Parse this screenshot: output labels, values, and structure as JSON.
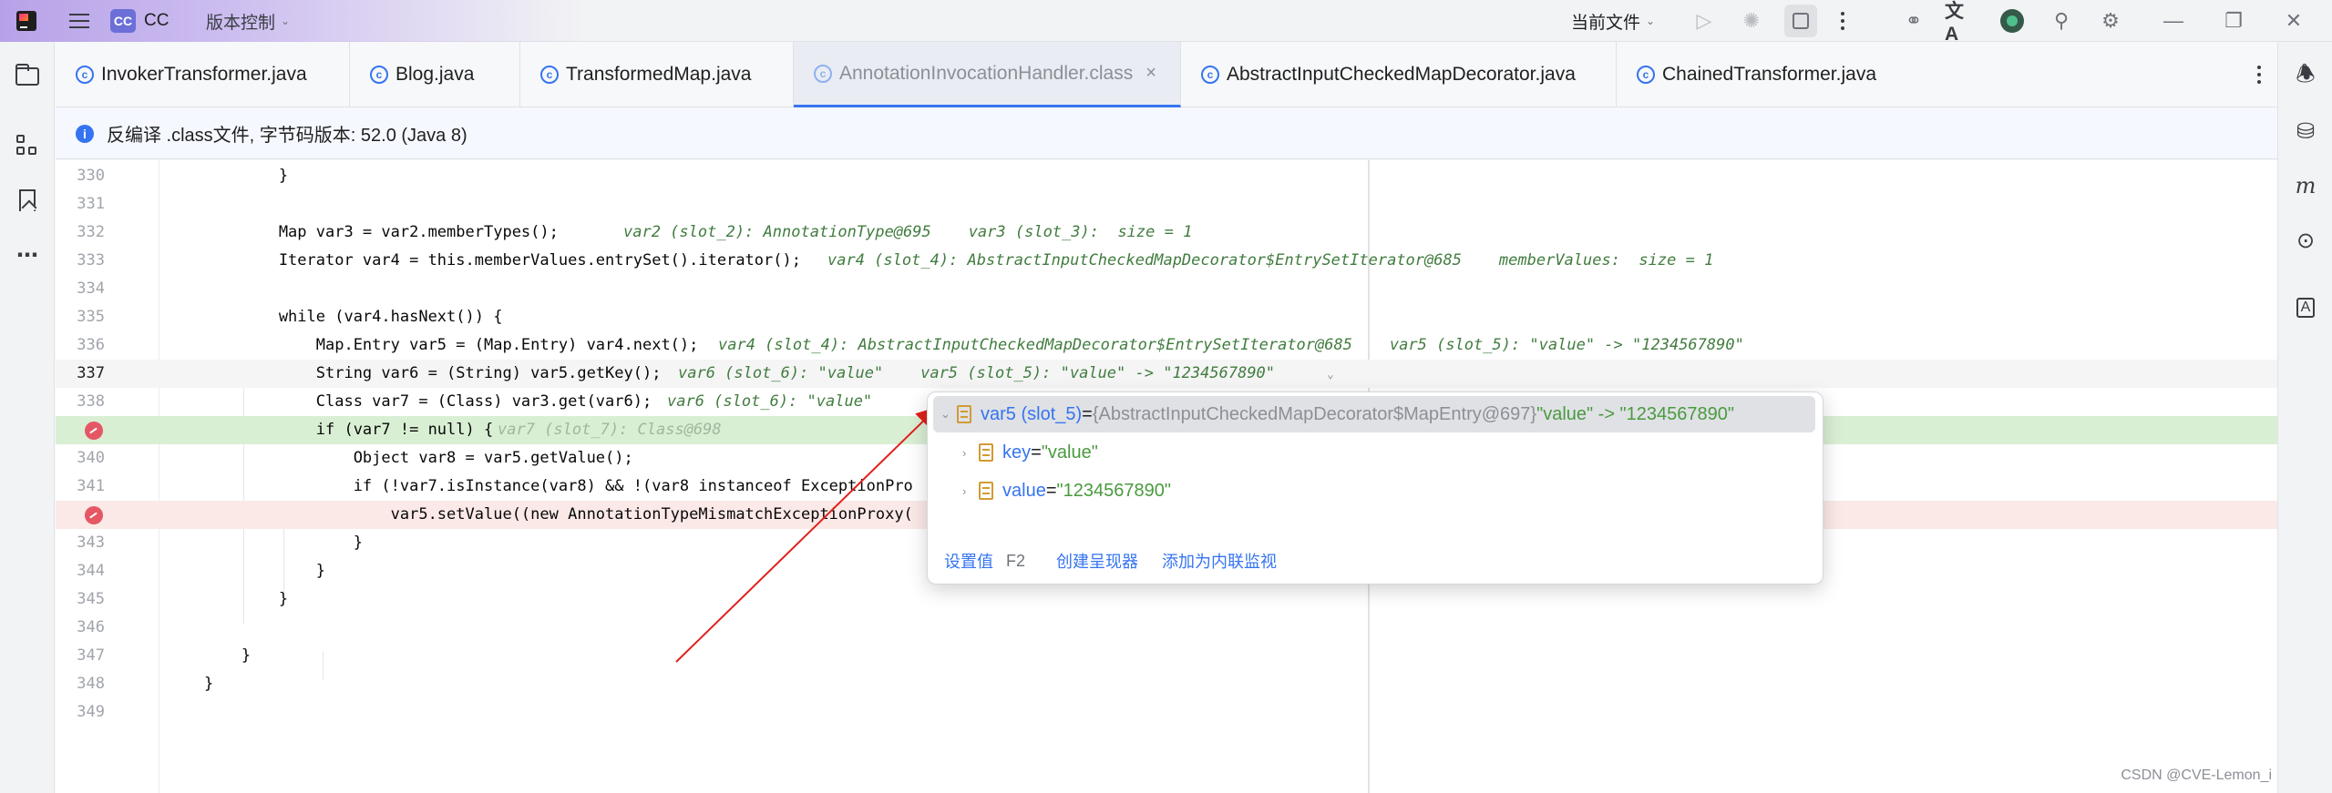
{
  "titlebar": {
    "project_badge": "CC",
    "project_name": "CC",
    "vcs_label": "版本控制",
    "current_file_label": "当前文件"
  },
  "tabs": [
    {
      "label": "InvokerTransformer.java",
      "active": false
    },
    {
      "label": "Blog.java",
      "active": false
    },
    {
      "label": "TransformedMap.java",
      "active": false
    },
    {
      "label": "AnnotationInvocationHandler.class",
      "active": true
    },
    {
      "label": "AbstractInputCheckedMapDecorator.java",
      "active": false
    },
    {
      "label": "ChainedTransformer.java",
      "active": false
    }
  ],
  "banner": {
    "text": "反编译 .class文件, 字节码版本: 52.0 (Java 8)"
  },
  "code_lines": [
    {
      "num": "330",
      "code": "            }",
      "hint": ""
    },
    {
      "num": "331",
      "code": "",
      "hint": ""
    },
    {
      "num": "332",
      "code": "            Map var3 = var2.memberTypes();",
      "hint": "var2 (slot_2): AnnotationType@695    var3 (slot_3):  size = 1"
    },
    {
      "num": "333",
      "code": "            Iterator var4 = this.memberValues.entrySet().iterator();",
      "hint": "var4 (slot_4): AbstractInputCheckedMapDecorator$EntrySetIterator@685    memberValues:  size = 1"
    },
    {
      "num": "334",
      "code": "",
      "hint": ""
    },
    {
      "num": "335",
      "code": "            while (var4.hasNext()) {",
      "hint": ""
    },
    {
      "num": "336",
      "code": "                Map.Entry var5 = (Map.Entry) var4.next();",
      "hint": "var4 (slot_4): AbstractInputCheckedMapDecorator$EntrySetIterator@685    var5 (slot_5): \"value\" -> \"1234567890\""
    },
    {
      "num": "337",
      "code": "                String var6 = (String) var5.getKey();",
      "hint": "var6 (slot_6): \"value\"    var5 (slot_5): \"value\" -> \"1234567890\""
    },
    {
      "num": "338",
      "code": "                Class var7 = (Class) var3.get(var6);",
      "hint": "var6 (slot_6): \"value\""
    },
    {
      "num": "339",
      "code": "                if (var7 != null) {",
      "hint": "var7 (slot_7): Class@698"
    },
    {
      "num": "340",
      "code": "                    Object var8 = var5.getValue();",
      "hint": ""
    },
    {
      "num": "341",
      "code": "                    if (!var7.isInstance(var8) && !(var8 instanceof ExceptionPro",
      "hint": ""
    },
    {
      "num": "342",
      "code": "                        var5.setValue((new AnnotationTypeMismatchExceptionProxy(",
      "hint": ""
    },
    {
      "num": "343",
      "code": "                    }",
      "hint": ""
    },
    {
      "num": "344",
      "code": "                }",
      "hint": ""
    },
    {
      "num": "345",
      "code": "            }",
      "hint": ""
    },
    {
      "num": "346",
      "code": "",
      "hint": ""
    },
    {
      "num": "347",
      "code": "        }",
      "hint": ""
    },
    {
      "num": "348",
      "code": "    }",
      "hint": ""
    },
    {
      "num": "349",
      "code": "",
      "hint": ""
    }
  ],
  "popup": {
    "root": {
      "name": "var5 (slot_5)",
      "eq": " = ",
      "type": "{AbstractInputCheckedMapDecorator$MapEntry@697}",
      "value": " \"value\" -> \"1234567890\""
    },
    "children": [
      {
        "name": "key",
        "eq": " = ",
        "value": "\"value\""
      },
      {
        "name": "value",
        "eq": " = ",
        "value": "\"1234567890\""
      }
    ],
    "actions": {
      "set_value": "设置值",
      "set_value_key": "F2",
      "create_renderer": "创建呈现器",
      "add_inline_watch": "添加为内联监视"
    }
  },
  "watermark": "CSDN @CVE-Lemon_i",
  "colors": {
    "accent": "#3574f0",
    "exec_line": "#d9efd4",
    "breakpoint_line": "#fbe9e7",
    "breakpoint": "#e55765",
    "annotation_arrow": "#e0201c"
  }
}
